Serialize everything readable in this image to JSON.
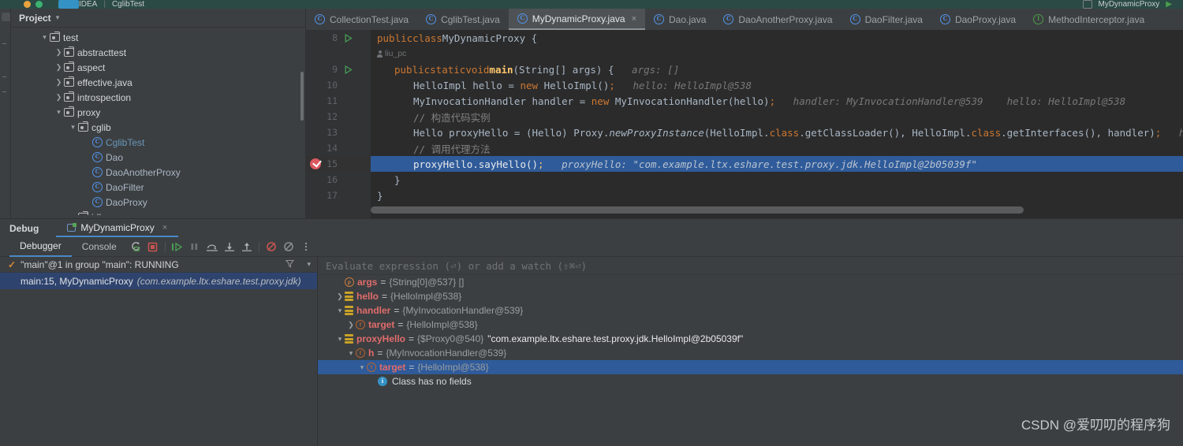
{
  "topbar": {
    "app_label": "IDEA",
    "file_label": "CglibTest",
    "separator": "|",
    "run_config": "MyDynamicProxy"
  },
  "project_panel": {
    "title": "Project",
    "tree": [
      {
        "indent": 2,
        "arrow": "v",
        "icon": "folder-icon",
        "label": "test",
        "type": "folder"
      },
      {
        "indent": 3,
        "arrow": ">",
        "icon": "folder-icon",
        "label": "abstracttest",
        "type": "folder"
      },
      {
        "indent": 3,
        "arrow": ">",
        "icon": "folder-icon",
        "label": "aspect",
        "type": "folder"
      },
      {
        "indent": 3,
        "arrow": ">",
        "icon": "folder-icon",
        "label": "effective.java",
        "type": "folder"
      },
      {
        "indent": 3,
        "arrow": ">",
        "icon": "folder-icon",
        "label": "introspection",
        "type": "folder"
      },
      {
        "indent": 3,
        "arrow": "v",
        "icon": "folder-icon",
        "label": "proxy",
        "type": "folder"
      },
      {
        "indent": 4,
        "arrow": "v",
        "icon": "folder-icon",
        "label": "cglib",
        "type": "folder"
      },
      {
        "indent": 5,
        "arrow": "",
        "icon": "class-icon",
        "label": "CglibTest",
        "type": "class-selected"
      },
      {
        "indent": 5,
        "arrow": "",
        "icon": "class-icon",
        "label": "Dao",
        "type": "class"
      },
      {
        "indent": 5,
        "arrow": "",
        "icon": "class-icon",
        "label": "DaoAnotherProxy",
        "type": "class"
      },
      {
        "indent": 5,
        "arrow": "",
        "icon": "class-icon",
        "label": "DaoFilter",
        "type": "class"
      },
      {
        "indent": 5,
        "arrow": "",
        "icon": "class-icon",
        "label": "DaoProxy",
        "type": "class"
      },
      {
        "indent": 4,
        "arrow": "v",
        "icon": "folder-icon",
        "label": "jdk",
        "type": "folder"
      }
    ]
  },
  "editor": {
    "tabs": [
      {
        "label": "CollectionTest.java",
        "icon": "class-icon",
        "active": false,
        "closable": false
      },
      {
        "label": "CglibTest.java",
        "icon": "class-icon",
        "active": false,
        "closable": false
      },
      {
        "label": "MyDynamicProxy.java",
        "icon": "class-icon",
        "active": true,
        "closable": true
      },
      {
        "label": "Dao.java",
        "icon": "class-icon",
        "active": false,
        "closable": false
      },
      {
        "label": "DaoAnotherProxy.java",
        "icon": "class-icon",
        "active": false,
        "closable": false
      },
      {
        "label": "DaoFilter.java",
        "icon": "class-icon",
        "active": false,
        "closable": false
      },
      {
        "label": "DaoProxy.java",
        "icon": "class-icon",
        "active": false,
        "closable": false
      },
      {
        "label": "MethodInterceptor.java",
        "icon": "interface-icon",
        "active": false,
        "closable": false
      }
    ],
    "close_glyph": "×",
    "author_annotation": "liu_pc",
    "lines": [
      {
        "num": "8",
        "gutter": "run",
        "breakpoint": false,
        "highlight": false
      },
      {
        "num": "",
        "gutter": "",
        "breakpoint": false,
        "highlight": false
      },
      {
        "num": "9",
        "gutter": "run",
        "breakpoint": false,
        "highlight": false
      },
      {
        "num": "10",
        "gutter": "",
        "breakpoint": false,
        "highlight": false
      },
      {
        "num": "11",
        "gutter": "",
        "breakpoint": false,
        "highlight": false
      },
      {
        "num": "12",
        "gutter": "",
        "breakpoint": false,
        "highlight": false
      },
      {
        "num": "13",
        "gutter": "",
        "breakpoint": false,
        "highlight": false
      },
      {
        "num": "14",
        "gutter": "",
        "breakpoint": false,
        "highlight": false
      },
      {
        "num": "15",
        "gutter": "",
        "breakpoint": true,
        "highlight": true
      },
      {
        "num": "16",
        "gutter": "",
        "breakpoint": false,
        "highlight": false
      },
      {
        "num": "17",
        "gutter": "",
        "breakpoint": false,
        "highlight": false
      }
    ],
    "code_text": {
      "l8": "public class MyDynamicProxy {",
      "l9": "public static void main(String[] args) {",
      "l9_hint": "args: []",
      "l10": "HelloImpl hello = new HelloImpl();",
      "l10_hint": "hello: HelloImpl@538",
      "l11": "MyInvocationHandler handler = new MyInvocationHandler(hello);",
      "l11_hint1": "handler: MyInvocationHandler@539",
      "l11_hint2": "hello: HelloImpl@538",
      "l12": "// 构造代码实例",
      "l13": "Hello proxyHello = (Hello) Proxy.newProxyInstance(HelloImpl.class.getClassLoader(), HelloImpl.class.getInterfaces(), handler);",
      "l13_hint": "handler: M",
      "l14": "// 调用代理方法",
      "l15": "proxyHello.sayHello();",
      "l15_hint": "proxyHello: \"com.example.ltx.eshare.test.proxy.jdk.HelloImpl@2b05039f\"",
      "l16": "}",
      "l17": "}"
    }
  },
  "debug": {
    "tabs": [
      {
        "label": "Debug",
        "selected": false,
        "bold": true,
        "icon": "",
        "closable": false
      },
      {
        "label": "MyDynamicProxy",
        "selected": true,
        "bold": false,
        "icon": "debug-session-icon",
        "closable": true
      }
    ],
    "close_glyph": "×",
    "subtabs": [
      {
        "label": "Debugger",
        "selected": true
      },
      {
        "label": "Console",
        "selected": false
      }
    ],
    "toolbar_icons": [
      "rerun-icon",
      "stop-icon",
      "resume-program-icon",
      "pause-program-icon",
      "step-over-icon",
      "step-into-icon",
      "step-out-icon",
      "mute-breakpoints-icon",
      "view-breakpoints-icon",
      "more-options-icon"
    ],
    "frames": {
      "thread_status": "\"main\"@1 in group \"main\": RUNNING",
      "filter_icon": "filter-icon",
      "dropdown_icon": "chevron-down-icon",
      "rows": [
        {
          "label": "main:15, MyDynamicProxy",
          "package": "(com.example.ltx.eshare.test.proxy.jdk)",
          "selected": true
        }
      ]
    },
    "variables": {
      "eval_placeholder": "Evaluate expression (⏎) or add a watch (⇧⌘⏎)",
      "rows": [
        {
          "indent": 1,
          "arrow": "",
          "icon": "parameter-icon",
          "name": "args",
          "value": "{String[0]@537} []",
          "string": "",
          "selected": false
        },
        {
          "indent": 1,
          "arrow": ">",
          "icon": "local-variable-icon",
          "name": "hello",
          "value": "{HelloImpl@538}",
          "string": "",
          "selected": false
        },
        {
          "indent": 1,
          "arrow": "v",
          "icon": "local-variable-icon",
          "name": "handler",
          "value": "{MyInvocationHandler@539}",
          "string": "",
          "selected": false
        },
        {
          "indent": 2,
          "arrow": ">",
          "icon": "field-icon",
          "name": "target",
          "value": "{HelloImpl@538}",
          "string": "",
          "selected": false
        },
        {
          "indent": 1,
          "arrow": "v",
          "icon": "local-variable-icon",
          "name": "proxyHello",
          "value": "{$Proxy0@540}",
          "string": "\"com.example.ltx.eshare.test.proxy.jdk.HelloImpl@2b05039f\"",
          "selected": false
        },
        {
          "indent": 2,
          "arrow": "v",
          "icon": "field-icon",
          "name": "h",
          "value": "{MyInvocationHandler@539}",
          "string": "",
          "selected": false
        },
        {
          "indent": 3,
          "arrow": "v",
          "icon": "field-icon",
          "name": "target",
          "value": "{HelloImpl@538}",
          "string": "",
          "selected": true
        },
        {
          "indent": 4,
          "arrow": "",
          "icon": "info-icon",
          "name": "",
          "value": "",
          "info": "Class has no fields",
          "selected": false
        }
      ]
    }
  },
  "watermark": "CSDN @爱叨叨的程序狗"
}
